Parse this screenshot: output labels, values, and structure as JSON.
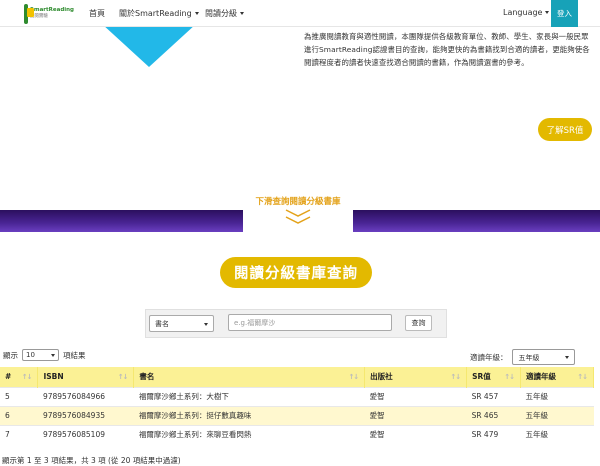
{
  "navbar": {
    "logo_line1": "SmartReading",
    "logo_line2": "愛閱實驗",
    "home": "首頁",
    "about": "關於SmartReading",
    "levels": "閱讀分級",
    "language": "Language",
    "login": "登入"
  },
  "intro": {
    "text": "為推廣閱讀教育與適性閱讀，本團隊提供各級教育單位、教師、學生、家長與一般民眾進行SmartReading認證書目的查詢，能夠更快的為書籍找到合適的讀者，更能夠使各閱讀程度者的讀者快速查找適合閱讀的書籍，作為閱讀選書的參考。",
    "learn_button": "了解SR值"
  },
  "scroll_label": "下滑查詢閱讀分級書庫",
  "search_section": {
    "title": "閱讀分級書庫查詢",
    "field_select": "書名",
    "placeholder": "e.g.福爾摩沙",
    "search_button": "查詢"
  },
  "controls": {
    "show_prefix": "顯示",
    "page_length": "10",
    "show_suffix": "項結果",
    "grade_label": "適讀年級：",
    "grade_value": "五年級"
  },
  "table": {
    "headers": [
      "#",
      "ISBN",
      "書名",
      "出版社",
      "SR值",
      "適讀年級"
    ],
    "rows": [
      [
        "5",
        "9789576084966",
        "福爾摩沙鄉土系列：大樹下",
        "愛智",
        "SR 457",
        "五年級"
      ],
      [
        "6",
        "9789576084935",
        "福爾摩沙鄉土系列：挺仔數真趣味",
        "愛智",
        "SR 465",
        "五年級"
      ],
      [
        "7",
        "9789576085109",
        "福爾摩沙鄉土系列：來聊豆看閃熱",
        "愛智",
        "SR 479",
        "五年級"
      ]
    ]
  },
  "info_text": "顯示第 1 至 3 項結果，共 3 項 (從 20 項結果中過濾)",
  "colors": {
    "accent_yellow": "#e3b900",
    "login_teal": "#17a2b8",
    "triangle_blue": "#22b8e8",
    "band_purple": "#4a2595",
    "header_yellow": "#fbf195"
  }
}
